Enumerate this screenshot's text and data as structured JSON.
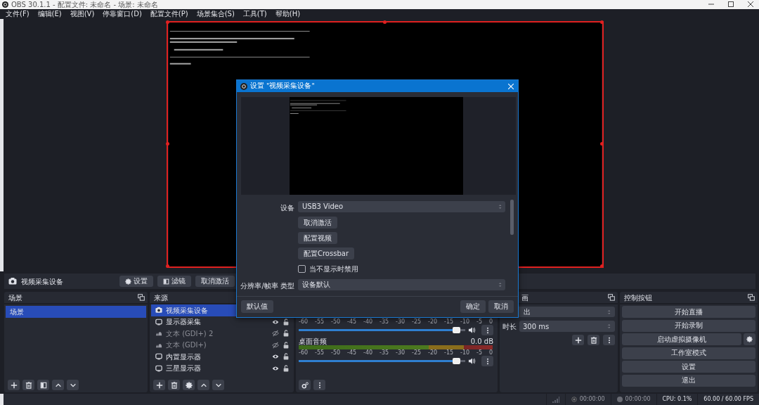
{
  "window": {
    "title": "OBS 30.1.1 - 配置文件: 未命名 - 场景: 未命名"
  },
  "menu": [
    "文件(F)",
    "编辑(E)",
    "视图(V)",
    "停靠窗口(D)",
    "配置文件(P)",
    "场景集合(S)",
    "工具(T)",
    "帮助(H)"
  ],
  "preview": {
    "kind": "picture",
    "selected": true
  },
  "source_toolbar": {
    "source": "视频采集设备",
    "buttons": [
      {
        "label": "设置",
        "kind": "settings"
      },
      {
        "label": "滤镜",
        "kind": "filters"
      },
      {
        "label": "取消激活",
        "kind": "plain"
      }
    ]
  },
  "scenes": {
    "title": "场景",
    "items": [
      {
        "label": "场景",
        "selected": true
      }
    ]
  },
  "sources": {
    "title": "来源",
    "items": [
      {
        "label": "视频采集设备",
        "kind": "camera",
        "selected": true
      },
      {
        "label": "显示器采集",
        "kind": "monitor",
        "selected": false,
        "visible": true,
        "locked": false
      },
      {
        "label": "文本 (GDI+) 2",
        "kind": "text",
        "selected": false,
        "visible": false,
        "locked": false
      },
      {
        "label": "文本 (GDI+)",
        "kind": "text",
        "selected": false,
        "visible": false,
        "locked": false
      },
      {
        "label": "内置显示器",
        "kind": "monitor",
        "selected": false,
        "visible": true,
        "locked": false
      },
      {
        "label": "三星显示器",
        "kind": "monitor",
        "selected": false,
        "visible": true,
        "locked": false
      }
    ]
  },
  "mixer": {
    "channels": [
      {
        "ticks": [
          "-60",
          "-55",
          "-50",
          "-45",
          "-40",
          "-35",
          "-30",
          "-25",
          "-20",
          "-15",
          "-10",
          "-5",
          "0"
        ],
        "level": 0.97
      },
      {
        "name": "桌面音频",
        "reading": "0.0 dB",
        "ticks": [
          "-60",
          "-55",
          "-50",
          "-45",
          "-40",
          "-35",
          "-30",
          "-25",
          "-20",
          "-15",
          "-10",
          "-5",
          "0"
        ],
        "level": 0.97
      }
    ]
  },
  "transitions": {
    "title": "画",
    "transition": "出",
    "duration_label": "时长",
    "duration": "300 ms"
  },
  "controls": {
    "title": "控制按钮",
    "buttons": [
      {
        "label": "开始直播",
        "kind": "plain"
      },
      {
        "label": "开始录制",
        "kind": "plain"
      },
      {
        "label": "启动虚拟摄像机",
        "kind": "with-settings"
      },
      {
        "label": "工作室模式",
        "kind": "plain"
      },
      {
        "label": "设置",
        "kind": "plain"
      },
      {
        "label": "退出",
        "kind": "plain"
      }
    ]
  },
  "status_bar": {
    "stream_time": "00:00:00",
    "record_time": "00:00:00",
    "cpu": "CPU: 0.1%",
    "fps": "60.00 / 60.00 FPS"
  },
  "dialog": {
    "title": "设置 \"视频采集设备\"",
    "preview": {
      "kind": "picture"
    },
    "fields": [
      {
        "kind": "select",
        "label": "设备",
        "value": "USB3 Video"
      },
      {
        "kind": "button",
        "label": "取消激活"
      },
      {
        "kind": "button",
        "label": "配置视频"
      },
      {
        "kind": "button",
        "label": "配置Crossbar"
      },
      {
        "kind": "checkbox",
        "label": "当不显示时禁用",
        "checked": false
      },
      {
        "kind": "select",
        "label": "分辨率/帧率 类型",
        "value": "设备默认"
      }
    ],
    "buttons": [
      {
        "label": "默认值",
        "kind": "reset"
      },
      {
        "label": "确定",
        "kind": "ok"
      },
      {
        "label": "取消",
        "kind": "cancel"
      }
    ]
  }
}
